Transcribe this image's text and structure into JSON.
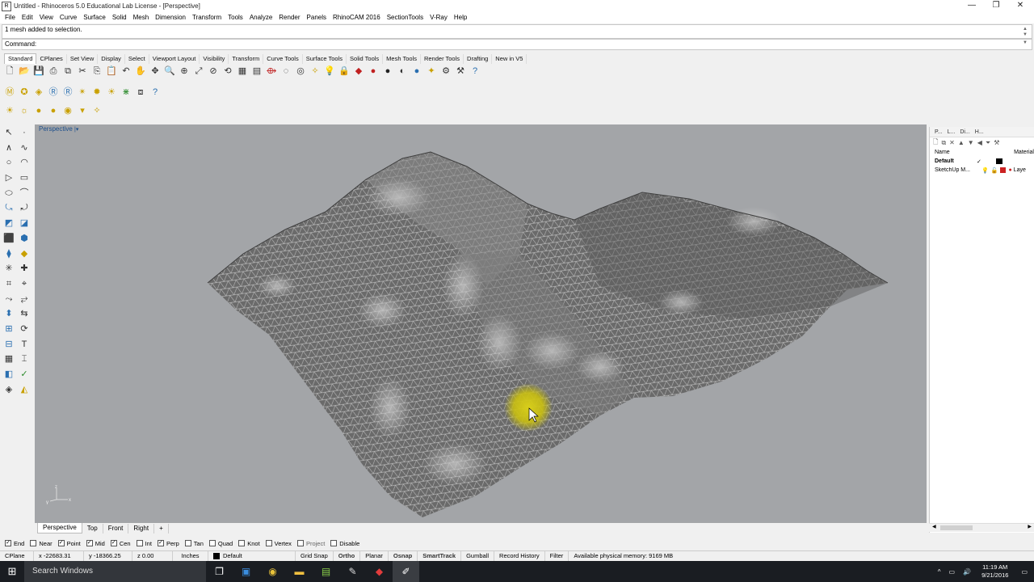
{
  "window": {
    "title": "Untitled - Rhinoceros 5.0 Educational Lab License - [Perspective]",
    "minimize": "—",
    "maximize": "❐",
    "close": "✕"
  },
  "menu": [
    "File",
    "Edit",
    "View",
    "Curve",
    "Surface",
    "Solid",
    "Mesh",
    "Dimension",
    "Transform",
    "Tools",
    "Analyze",
    "Render",
    "Panels",
    "RhinoCAM 2016",
    "SectionTools",
    "V-Ray",
    "Help"
  ],
  "command_history": "1 mesh added to selection.",
  "command_prompt": "Command:",
  "toolbar_tabs": [
    "Standard",
    "CPlanes",
    "Set View",
    "Display",
    "Select",
    "Viewport Layout",
    "Visibility",
    "Transform",
    "Curve Tools",
    "Surface Tools",
    "Solid Tools",
    "Mesh Tools",
    "Render Tools",
    "Drafting",
    "New in V5"
  ],
  "toolbar_tab_active": 0,
  "viewport": {
    "label": "Perspective",
    "axes_label": "z\ny  x"
  },
  "viewport_tabs": [
    "Perspective",
    "Top",
    "Front",
    "Right",
    "+"
  ],
  "viewport_tab_active": 0,
  "layers_panel": {
    "tabs": [
      "P...",
      "L...",
      "Di...",
      "H..."
    ],
    "col_name": "Name",
    "col_material": "Material",
    "layers": [
      {
        "name": "Default",
        "current": "✓",
        "color": "#000000"
      },
      {
        "name": "SketchUp M...",
        "current": "",
        "color": "#cc2222",
        "material": "Laye"
      }
    ]
  },
  "osnaps": [
    {
      "label": "End",
      "checked": true
    },
    {
      "label": "Near",
      "checked": false
    },
    {
      "label": "Point",
      "checked": true
    },
    {
      "label": "Mid",
      "checked": true
    },
    {
      "label": "Cen",
      "checked": true
    },
    {
      "label": "Int",
      "checked": false
    },
    {
      "label": "Perp",
      "checked": true
    },
    {
      "label": "Tan",
      "checked": false
    },
    {
      "label": "Quad",
      "checked": false
    },
    {
      "label": "Knot",
      "checked": false
    },
    {
      "label": "Vertex",
      "checked": false
    },
    {
      "label": "Project",
      "checked": false
    },
    {
      "label": "Disable",
      "checked": false
    }
  ],
  "status": {
    "cplane": "CPlane",
    "x": "x -22683.31",
    "y": "y -18366.25",
    "z": "z 0.00",
    "units": "Inches",
    "layer": "Default",
    "grid_snap": "Grid Snap",
    "ortho": "Ortho",
    "planar": "Planar",
    "osnap": "Osnap",
    "smarttrack": "SmartTrack",
    "gumball": "Gumball",
    "record_history": "Record History",
    "filter": "Filter",
    "memory": "Available physical memory: 9169 MB"
  },
  "taskbar": {
    "search": "Search Windows",
    "time": "11:19 AM",
    "date": "9/21/2016"
  },
  "colors": {
    "viewport_bg": "#a3a5a8",
    "mesh": "#6f6f6f",
    "cursor_highlight": "#d6cc00",
    "taskbar": "#1a1d22"
  }
}
